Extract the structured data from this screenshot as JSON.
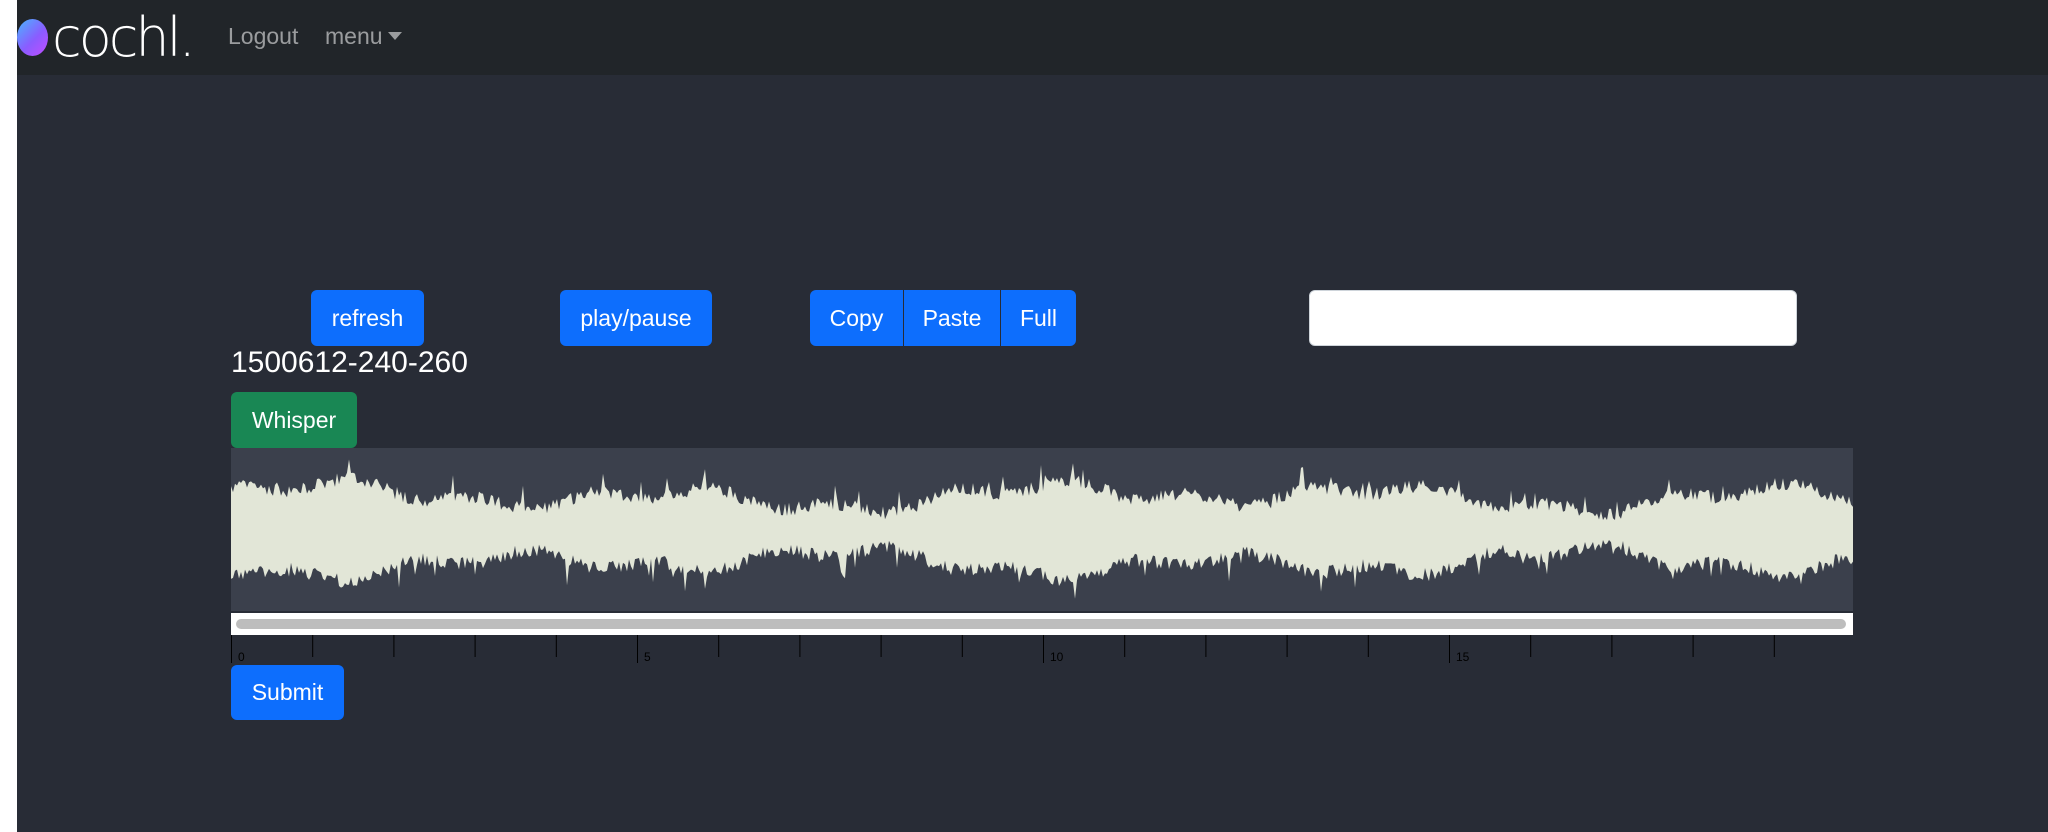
{
  "navbar": {
    "brand": "cochl.",
    "logout_label": "Logout",
    "menu_label": "menu"
  },
  "toolbar": {
    "refresh_label": "refresh",
    "play_pause_label": "play/pause",
    "copy_label": "Copy",
    "paste_label": "Paste",
    "full_label": "Full",
    "text_input_value": "",
    "text_input_placeholder": ""
  },
  "clip": {
    "id": "1500612-240-260"
  },
  "whisper_label": "Whisper",
  "waveform": {
    "wave_color": "#e2e6d7",
    "background_color": "#3b404c"
  },
  "timeline": {
    "duration_seconds": 20,
    "tick_step_seconds": 1,
    "labels": [
      "0",
      "5",
      "10",
      "15"
    ]
  },
  "submit_label": "Submit",
  "colors": {
    "primary": "#0d6efd",
    "success": "#198754",
    "navbar_bg": "#212529",
    "page_bg": "#282c36"
  }
}
